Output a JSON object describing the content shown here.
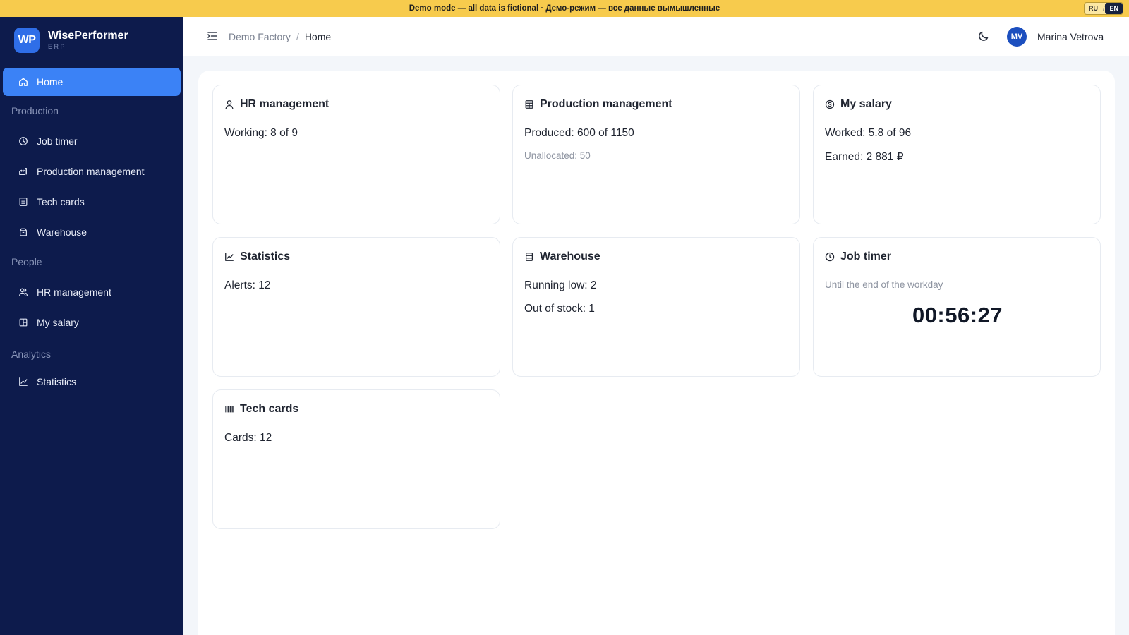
{
  "banner": {
    "text": "Demo mode — all data is fictional · Демо-режим — все данные вымышленные",
    "lang_ru": "RU",
    "lang_sep": "/",
    "lang_en": "EN"
  },
  "brand": {
    "logo": "WP",
    "name": "WisePerformer",
    "sub": "ERP"
  },
  "sidebar": {
    "home": "Home",
    "group_production": "Production",
    "job_timer": "Job timer",
    "production_management": "Production management",
    "tech_cards": "Tech cards",
    "warehouse": "Warehouse",
    "group_people": "People",
    "hr_management": "HR management",
    "my_salary": "My salary",
    "group_analytics": "Analytics",
    "statistics": "Statistics"
  },
  "header": {
    "breadcrumb_root": "Demo Factory",
    "breadcrumb_sep": "/",
    "breadcrumb_current": "Home",
    "avatar_initials": "MV",
    "user_name": "Marina Vetrova"
  },
  "cards": {
    "hr": {
      "title": "HR management",
      "line1": "Working: 8 of 9"
    },
    "production": {
      "title": "Production management",
      "line1": "Produced: 600 of 1150",
      "line2": "Unallocated: 50"
    },
    "salary": {
      "title": "My salary",
      "line1": "Worked: 5.8 of 96",
      "line2": "Earned: 2 881 ₽"
    },
    "statistics": {
      "title": "Statistics",
      "line1": "Alerts: 12"
    },
    "warehouse": {
      "title": "Warehouse",
      "line1": "Running low: 2",
      "line2": "Out of stock: 1"
    },
    "timer": {
      "title": "Job timer",
      "subtitle": "Until the end of the workday",
      "value": "00:56:27"
    },
    "techcards": {
      "title": "Tech cards",
      "line1": "Cards: 12"
    }
  },
  "colors": {
    "banner": "#f7cb4d",
    "sidebar": "#0d1b4c",
    "accent": "#3b82f6",
    "avatar": "#1c4fbf"
  }
}
